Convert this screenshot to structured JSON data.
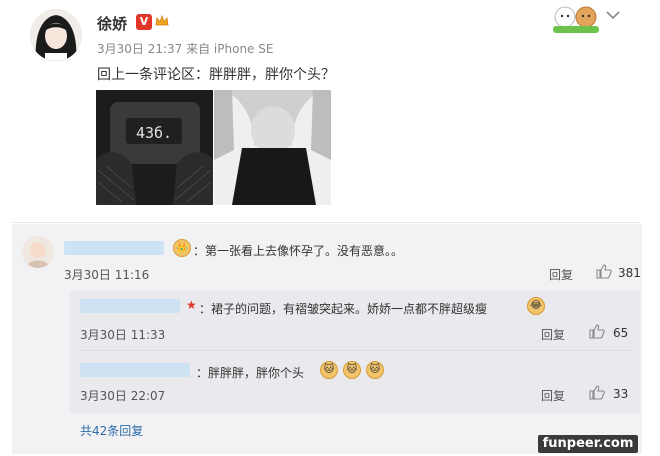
{
  "post": {
    "author": "徐娇",
    "verified_badge": "V",
    "meta": "3月30日 21:37 来自 iPhone SE",
    "text": "回上一条评论区：胖胖胖，胖你个头？",
    "photos": [
      {
        "name": "scale-photo",
        "overlay_text": "43б."
      },
      {
        "name": "waist-photo"
      }
    ]
  },
  "comments": [
    {
      "text": "：第一张看上去像怀孕了。没有恶意。。",
      "time": "3月30日 11:16",
      "reply_label": "回复",
      "likes": "381"
    }
  ],
  "replies": [
    {
      "text": "：裙子的问题，有褶皱突起来。娇娇一点都不胖超级瘦",
      "time": "3月30日 11:33",
      "reply_label": "回复",
      "likes": "65"
    },
    {
      "text": "：胖胖胖，胖你个头",
      "time": "3月30日 22:07",
      "reply_label": "回复",
      "likes": "33"
    }
  ],
  "more_replies": "共42条回复",
  "watermark": "funpeer.com",
  "colors": {
    "link": "#2f6ea8",
    "badge": "#e0372a",
    "panel": "#f2f2f5"
  }
}
